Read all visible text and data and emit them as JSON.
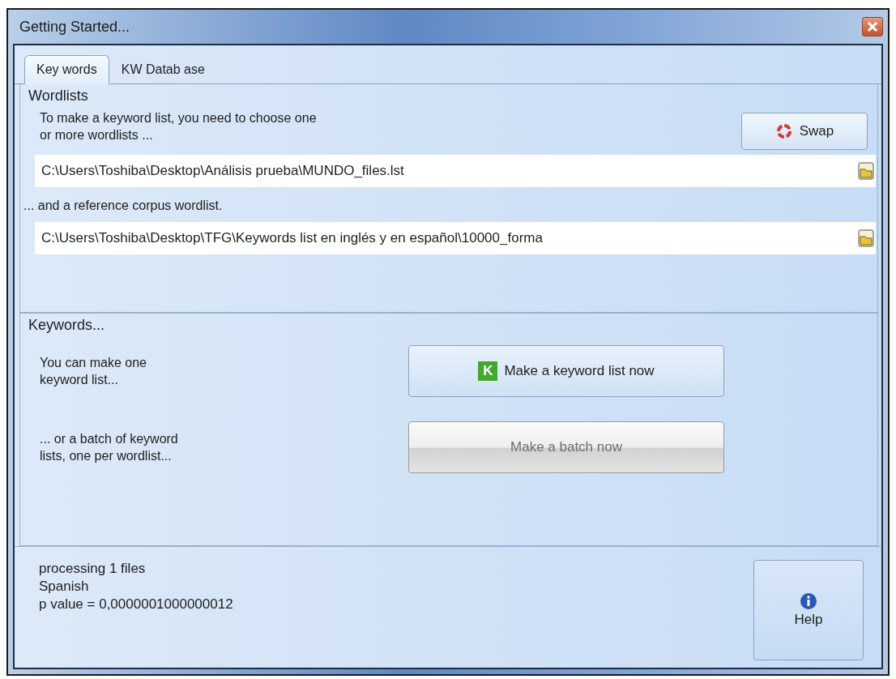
{
  "window": {
    "title": "Getting Started..."
  },
  "tabs": [
    {
      "label": "Key words",
      "selected": true
    },
    {
      "label": "KW Datab ase",
      "selected": false
    }
  ],
  "wordlists": {
    "title": "Wordlists",
    "instruction": "To make a keyword list, you need to choose one\nor more wordlists ...",
    "swap_button": "Swap",
    "wordlist_path": "C:\\Users\\Toshiba\\Desktop\\Análisis prueba\\MUNDO_files.lst",
    "reference_label": "... and a reference corpus wordlist.",
    "reference_path": "C:\\Users\\Toshiba\\Desktop\\TFG\\Keywords list en inglés y en español\\10000_forma"
  },
  "keywords": {
    "title": "Keywords...",
    "rows": [
      {
        "text": "You can make one\nkeyword list...",
        "button": "Make a keyword list now",
        "icon_text": "K",
        "disabled": false
      },
      {
        "text": "... or a batch of keyword\nlists, one per wordlist...",
        "button": "Make a batch now",
        "disabled": true
      }
    ]
  },
  "status": [
    "processing 1 files",
    "Spanish",
    "p value = 0,0000001000000012"
  ],
  "help_button": "Help"
}
